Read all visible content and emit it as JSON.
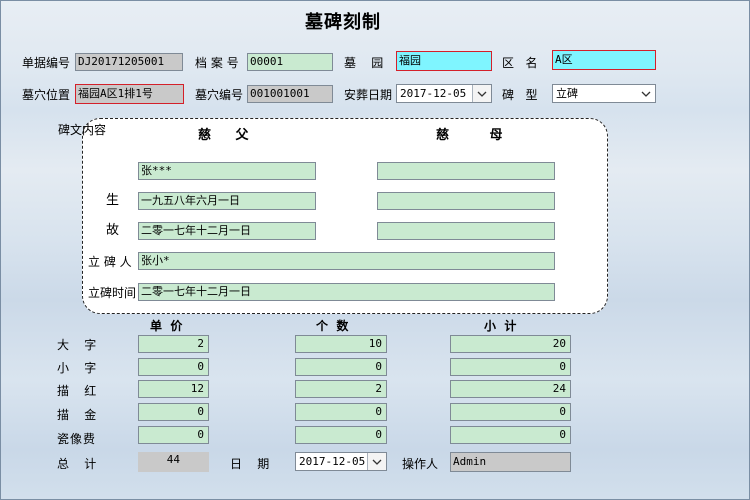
{
  "title": "墓碑刻制",
  "header": {
    "doc_no_label": "单据编号",
    "doc_no": "DJ20171205001",
    "archive_no_label": "档 案 号",
    "archive_no": "00001",
    "cemetery_label": "墓    园",
    "cemetery": "福园",
    "area_label": "区   名",
    "area": "A区",
    "position_label": "墓穴位置",
    "position": "福园A区1排1号",
    "tomb_no_label": "墓穴编号",
    "tomb_no": "001001001",
    "burial_date_label": "安葬日期",
    "burial_date": "2017-12-05",
    "stone_type_label": "碑   型",
    "stone_type": "立碑"
  },
  "inscription": {
    "section_label": "碑文内容",
    "father_label": "慈 父",
    "mother_label": "慈 母",
    "father_name": "张***",
    "mother_name": "",
    "birth_label": "生",
    "father_birth": "一九五八年六月一日",
    "mother_birth": "",
    "death_label": "故",
    "father_death": "二零一七年十二月一日",
    "mother_death": "",
    "erector_label": "立 碑 人",
    "erector": "张小*",
    "erect_time_label": "立碑时间",
    "erect_time": "二零一七年十二月一日"
  },
  "pricing": {
    "col_price": "单  价",
    "col_count": "个  数",
    "col_subtotal": "小  计",
    "rows": [
      {
        "label": "大    字",
        "price": "2",
        "count": "10",
        "subtotal": "20"
      },
      {
        "label": "小    字",
        "price": "0",
        "count": "0",
        "subtotal": "0"
      },
      {
        "label": "描    红",
        "price": "12",
        "count": "2",
        "subtotal": "24"
      },
      {
        "label": "描    金",
        "price": "0",
        "count": "0",
        "subtotal": "0"
      },
      {
        "label": "瓷像费",
        "price": "0",
        "count": "0",
        "subtotal": "0"
      }
    ],
    "total_label": "总    计",
    "total": "44",
    "date_label": "日    期",
    "date": "2017-12-05",
    "operator_label": "操作人",
    "operator": "Admin"
  }
}
